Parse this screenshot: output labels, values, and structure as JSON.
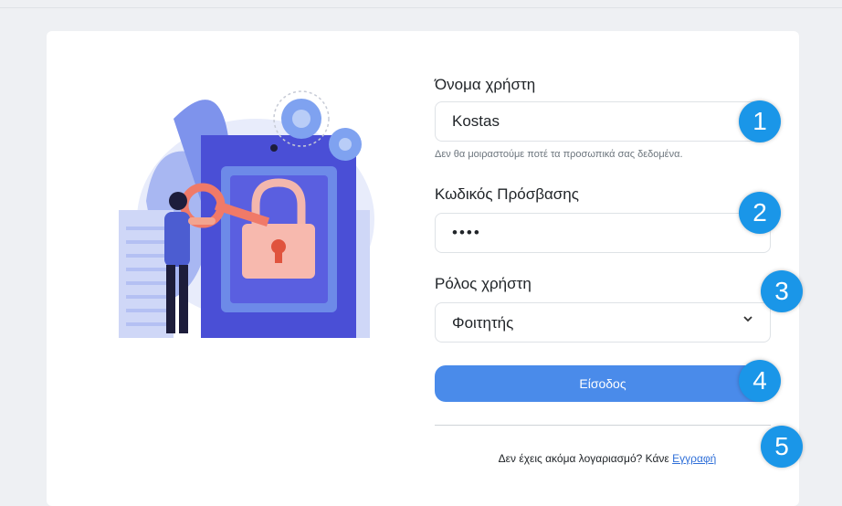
{
  "form": {
    "username_label": "Όνομα χρήστη",
    "username_value": "Kostas",
    "username_help": "Δεν θα μοιραστούμε ποτέ τα προσωπικά σας δεδομένα.",
    "password_label": "Κωδικός Πρόσβασης",
    "password_value": "••••",
    "role_label": "Ρόλος χρήστη",
    "role_value": "Φοιτητής",
    "submit_label": "Είσοδος",
    "footer_text": "Δεν έχεις ακόμα λογαριασμό? Κάνε ",
    "register_link": "Εγγραφή"
  },
  "badges": [
    "1",
    "2",
    "3",
    "4",
    "5"
  ],
  "colors": {
    "accent": "#4a8bea",
    "badge": "#1a96e8",
    "link": "#2f6fd8"
  }
}
